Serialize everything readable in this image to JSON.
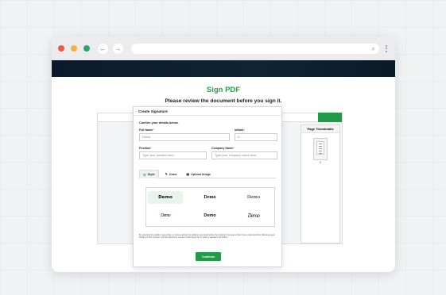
{
  "page": {
    "title": "Sign PDF",
    "subtitle": "Please review the document before you sign it."
  },
  "browser": {
    "back_icon": "←",
    "forward_icon": "→",
    "search_icon": "⌕"
  },
  "thumbnails": {
    "title": "Page Thumbnails",
    "pages": [
      "1"
    ]
  },
  "modal": {
    "title": "Create Signature",
    "section": "Confirm your details below.",
    "full_name": {
      "label": "Full Name",
      "required": "*",
      "value": "Demo"
    },
    "initials": {
      "label": "Initials",
      "required": "*",
      "value": "D"
    },
    "position": {
      "label": "Position",
      "required": "*",
      "placeholder": "Type your position here"
    },
    "company": {
      "label": "Company Name",
      "required": "*",
      "placeholder": "Type your company name here"
    },
    "tabs": [
      {
        "label": "Style",
        "icon": "☷"
      },
      {
        "label": "Draw",
        "icon": "✎"
      },
      {
        "label": "Upload Image",
        "icon": "▣"
      }
    ],
    "signature_styles": [
      "Demo",
      "Demo",
      "Demo",
      "Demo",
      "Demo",
      "Demo"
    ],
    "disclaimer": "By selecting the details I agree that my above outline the sidelines are legal before the original. If we agree that I have understood the following legal binding of this contract, and the electronic one are confirmed to be of value a signature as written.",
    "continue_label": "Continue"
  },
  "colors": {
    "accent": "#1f9b47",
    "title": "#24a04a",
    "topbar": "#0b1a2c"
  }
}
